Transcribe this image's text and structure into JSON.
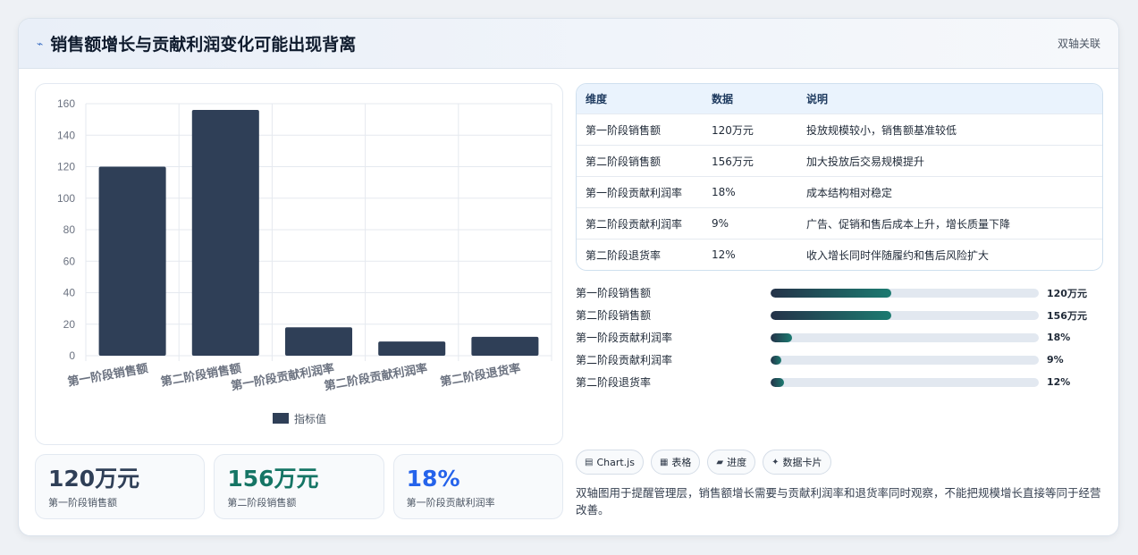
{
  "header": {
    "icon": "sparkline-icon",
    "title": "销售额增长与贡献利润变化可能出现背离",
    "tag": "双轴关联"
  },
  "chart_data": {
    "type": "bar",
    "categories": [
      "第一阶段销售额",
      "第二阶段销售额",
      "第一阶段贡献利润率",
      "第二阶段贡献利润率",
      "第二阶段退货率"
    ],
    "series": [
      {
        "name": "指标值",
        "values": [
          120,
          156,
          18,
          9,
          12
        ],
        "color": "#2f3f57"
      }
    ],
    "y_ticks": [
      "0",
      "20",
      "40",
      "60",
      "80",
      "100",
      "120",
      "140",
      "160"
    ],
    "ylim": [
      0,
      160
    ],
    "grid": true,
    "legend": "bottom"
  },
  "kpis": [
    {
      "value": "120万元",
      "label": "第一阶段销售额",
      "color": "#2f3f57"
    },
    {
      "value": "156万元",
      "label": "第二阶段销售额",
      "color": "#157565"
    },
    {
      "value": "18%",
      "label": "第一阶段贡献利润率",
      "color": "#2563eb"
    }
  ],
  "table": {
    "headers": [
      "维度",
      "数据",
      "说明"
    ],
    "rows": [
      [
        "第一阶段销售额",
        "120万元",
        "投放规模较小，销售额基准较低"
      ],
      [
        "第二阶段销售额",
        "156万元",
        "加大投放后交易规模提升"
      ],
      [
        "第一阶段贡献利润率",
        "18%",
        "成本结构相对稳定"
      ],
      [
        "第二阶段贡献利润率",
        "9%",
        "广告、促销和售后成本上升，增长质量下降"
      ],
      [
        "第二阶段退货率",
        "12%",
        "收入增长同时伴随履约和售后风险扩大"
      ]
    ]
  },
  "progress": [
    {
      "label": "第一阶段销售额",
      "value": "120万元",
      "fraction": 0.45
    },
    {
      "label": "第二阶段销售额",
      "value": "156万元",
      "fraction": 0.45
    },
    {
      "label": "第一阶段贡献利润率",
      "value": "18%",
      "fraction": 0.08
    },
    {
      "label": "第二阶段贡献利润率",
      "value": "9%",
      "fraction": 0.04
    },
    {
      "label": "第二阶段退货率",
      "value": "12%",
      "fraction": 0.05
    }
  ],
  "chips": [
    {
      "icon": "chart-icon",
      "glyph": "▤",
      "label": "Chart.js"
    },
    {
      "icon": "table-icon",
      "glyph": "▦",
      "label": "表格"
    },
    {
      "icon": "folder-icon",
      "glyph": "▰",
      "label": "进度"
    },
    {
      "icon": "sparkle-icon",
      "glyph": "✦",
      "label": "数据卡片"
    }
  ],
  "note": "双轴图用于提醒管理层，销售额增长需要与贡献利润率和退货率同时观察，不能把规模增长直接等同于经营改善。"
}
